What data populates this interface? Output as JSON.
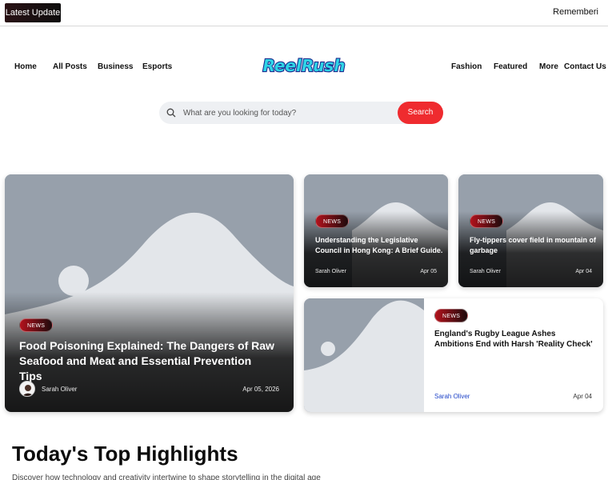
{
  "topbar": {
    "latest_label": "Latest Update",
    "ticker_text": "Rememberi"
  },
  "brand": {
    "logo_text": "ReelRush",
    "logo_colors": {
      "fill": "#2fd4e6",
      "outline": "#1b2b8f"
    }
  },
  "nav": {
    "left": [
      "Home",
      "All Posts",
      "Business",
      "Esports"
    ],
    "right": [
      "Fashion",
      "Featured",
      "More",
      "Contact Us"
    ]
  },
  "search": {
    "placeholder": "What are you looking for today?",
    "button_label": "Search",
    "icon": "search-icon"
  },
  "featured": {
    "badge": "NEWS",
    "title": "Food Poisoning Explained: The Dangers of Raw Seafood and Meat and Essential Prevention Tips",
    "author": "Sarah Oliver",
    "date": "Apr 05, 2026"
  },
  "side_cards": [
    {
      "badge": "NEWS",
      "title": "Understanding the Legislative Council in Hong Kong: A Brief Guide.",
      "author": "Sarah Oliver",
      "date": "Apr 05"
    },
    {
      "badge": "NEWS",
      "title": "Fly-tippers cover field in mountain of garbage",
      "author": "Sarah Oliver",
      "date": "Apr 04"
    },
    {
      "badge": "NEWS",
      "title": "England's Rugby League Ashes Ambitions End with Harsh 'Reality Check'",
      "author": "Sarah Oliver",
      "date": "Apr 04"
    }
  ],
  "highlights": {
    "title": "Today's Top Highlights",
    "subtitle": "Discover how technology and creativity intertwine to shape storytelling in the digital age"
  },
  "colors": {
    "accent": "#ef2b2f",
    "placeholder_image": "#97a0ab",
    "link_blue": "#1f44c8"
  }
}
